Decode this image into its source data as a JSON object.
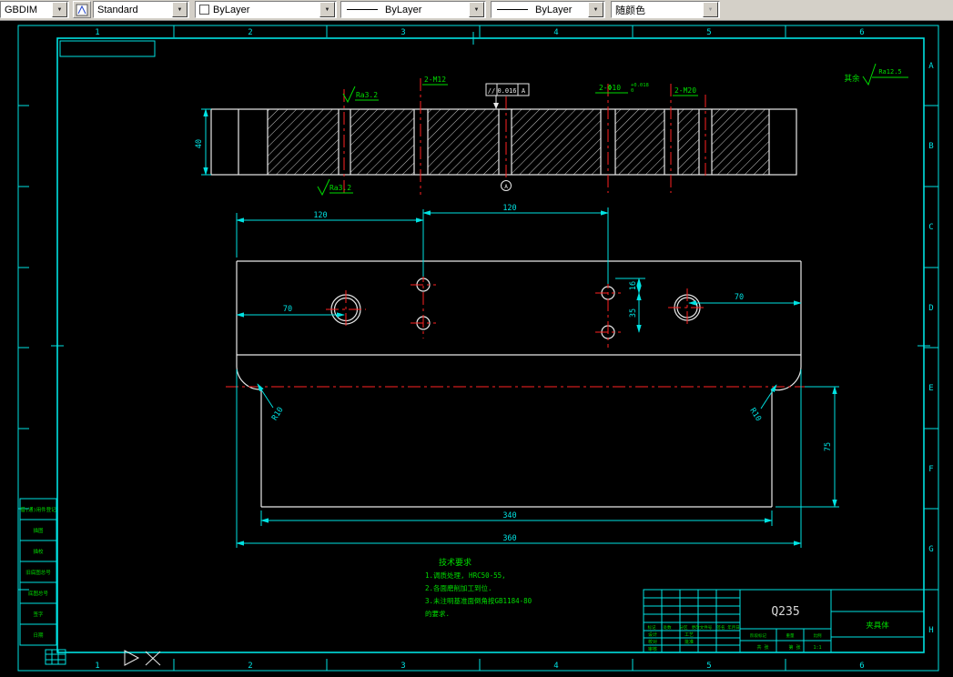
{
  "toolbar": {
    "dim_style": "GBDIM",
    "text_style": "Standard",
    "color": "ByLayer",
    "linetype": "ByLayer",
    "lineweight": "ByLayer",
    "plot_style": "随颜色"
  },
  "sheet": {
    "cols": [
      "1",
      "2",
      "3",
      "4",
      "5",
      "6"
    ],
    "rows": [
      "A",
      "B",
      "C",
      "D",
      "E",
      "F",
      "G",
      "H"
    ]
  },
  "annotations": {
    "rest_label": "其余",
    "rest_ra": "Ra12.5",
    "ra_top": "Ra3.2",
    "ra_bottom": "Ra3.2",
    "thread_left": "2-M12",
    "fcf_symbol": "//",
    "fcf_tolerance": "0.016",
    "fcf_datum": "A",
    "holes_label": "2-Φ10",
    "holes_tol_upper": "+0.018",
    "holes_tol_lower": "0",
    "thread_right": "2-M20",
    "datum_label": "A"
  },
  "dimensions": {
    "height": "40",
    "pitch_left": "120",
    "pitch_right": "120",
    "edge_left": "70",
    "edge_right": "70",
    "offset_small": "16",
    "offset_large": "35",
    "depth": "75",
    "width_inner": "340",
    "width_outer": "360",
    "radius_left": "R10",
    "radius_right": "R10"
  },
  "tech_requirements": {
    "title": "技术要求",
    "lines": [
      "1.调质处理, HRC50-55,",
      "2.各面磨削加工到位.",
      "3.未注明基准面倒角按GB1184-80",
      "的要求."
    ]
  },
  "margin_fields": [
    "借(通)用件登记",
    "描图",
    "描校",
    "旧底图总号",
    "底图总号",
    "签字",
    "日期"
  ],
  "title_block": {
    "material": "Q235",
    "part_name": "夹具体",
    "rev_headers": [
      "标记",
      "处数",
      "分区",
      "更改文件号",
      "签名",
      "年月日"
    ],
    "sig_labels": [
      "设计",
      "校对",
      "审核",
      "工艺",
      "批准"
    ],
    "stage_label": "阶段标记",
    "weight_label": "重量",
    "scale_label": "比例",
    "scale_value": "1:1",
    "sheet_total": "共 张",
    "sheet_number": "第 张"
  },
  "colors": {
    "background": "#000000",
    "frame": "#00e2e2",
    "outline": "#e8e8e8",
    "centerline": "#ff2222",
    "annotation": "#00dd00",
    "toolbar": "#d4d0c8"
  }
}
